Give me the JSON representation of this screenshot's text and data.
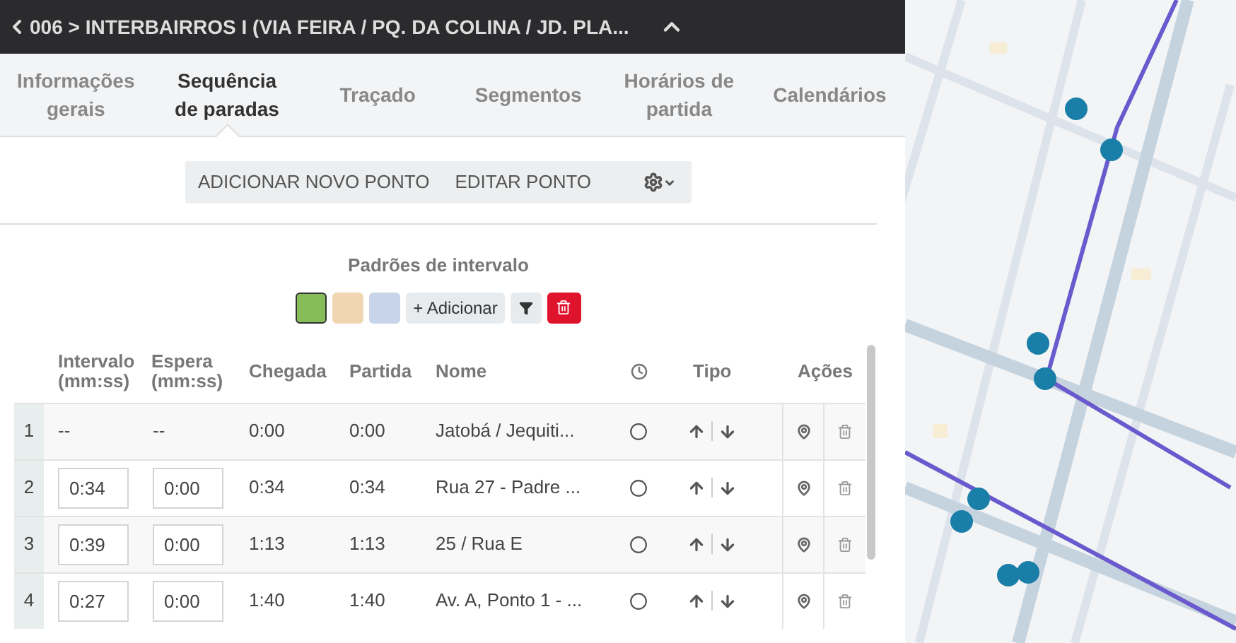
{
  "header": {
    "title": "006 > INTERBAIRROS I (VIA FEIRA / PQ. DA COLINA / JD. PLA..."
  },
  "tabs": [
    {
      "label": "Informações gerais",
      "selected": false
    },
    {
      "label": "Sequência de paradas",
      "selected": true
    },
    {
      "label": "Traçado",
      "selected": false
    },
    {
      "label": "Segmentos",
      "selected": false
    },
    {
      "label": "Horários de partida",
      "selected": false
    },
    {
      "label": "Calendários",
      "selected": false
    }
  ],
  "toolbar": {
    "buttons": [
      "ADICIONAR NOVO PONTO",
      "EDITAR PONTO"
    ]
  },
  "interval_patterns": {
    "title": "Padrões de intervalo",
    "swatches": [
      {
        "color": "#86bc5a",
        "selected": true
      },
      {
        "color": "#f2d6b3",
        "selected": false
      },
      {
        "color": "#c8d4ea",
        "selected": false
      }
    ],
    "add_button": "+ Adicionar"
  },
  "table": {
    "columns": [
      "Intervalo (mm:ss)",
      "Espera (mm:ss)",
      "Chegada",
      "Partida",
      "Nome",
      "Tipo",
      "Ações"
    ],
    "rows": [
      {
        "number": "1",
        "interval": "--",
        "wait": "--",
        "arrival": "0:00",
        "departure": "0:00",
        "name": "Jatobá / Jequiti..."
      },
      {
        "number": "2",
        "interval": "0:34",
        "wait": "0:00",
        "arrival": "0:34",
        "departure": "0:34",
        "name": "Rua 27 - Padre ..."
      },
      {
        "number": "3",
        "interval": "0:39",
        "wait": "0:00",
        "arrival": "1:13",
        "departure": "1:13",
        "name": "25 / Rua E"
      },
      {
        "number": "4",
        "interval": "0:27",
        "wait": "0:00",
        "arrival": "1:40",
        "departure": "1:40",
        "name": "Av. A, Ponto 1 - ..."
      }
    ]
  }
}
